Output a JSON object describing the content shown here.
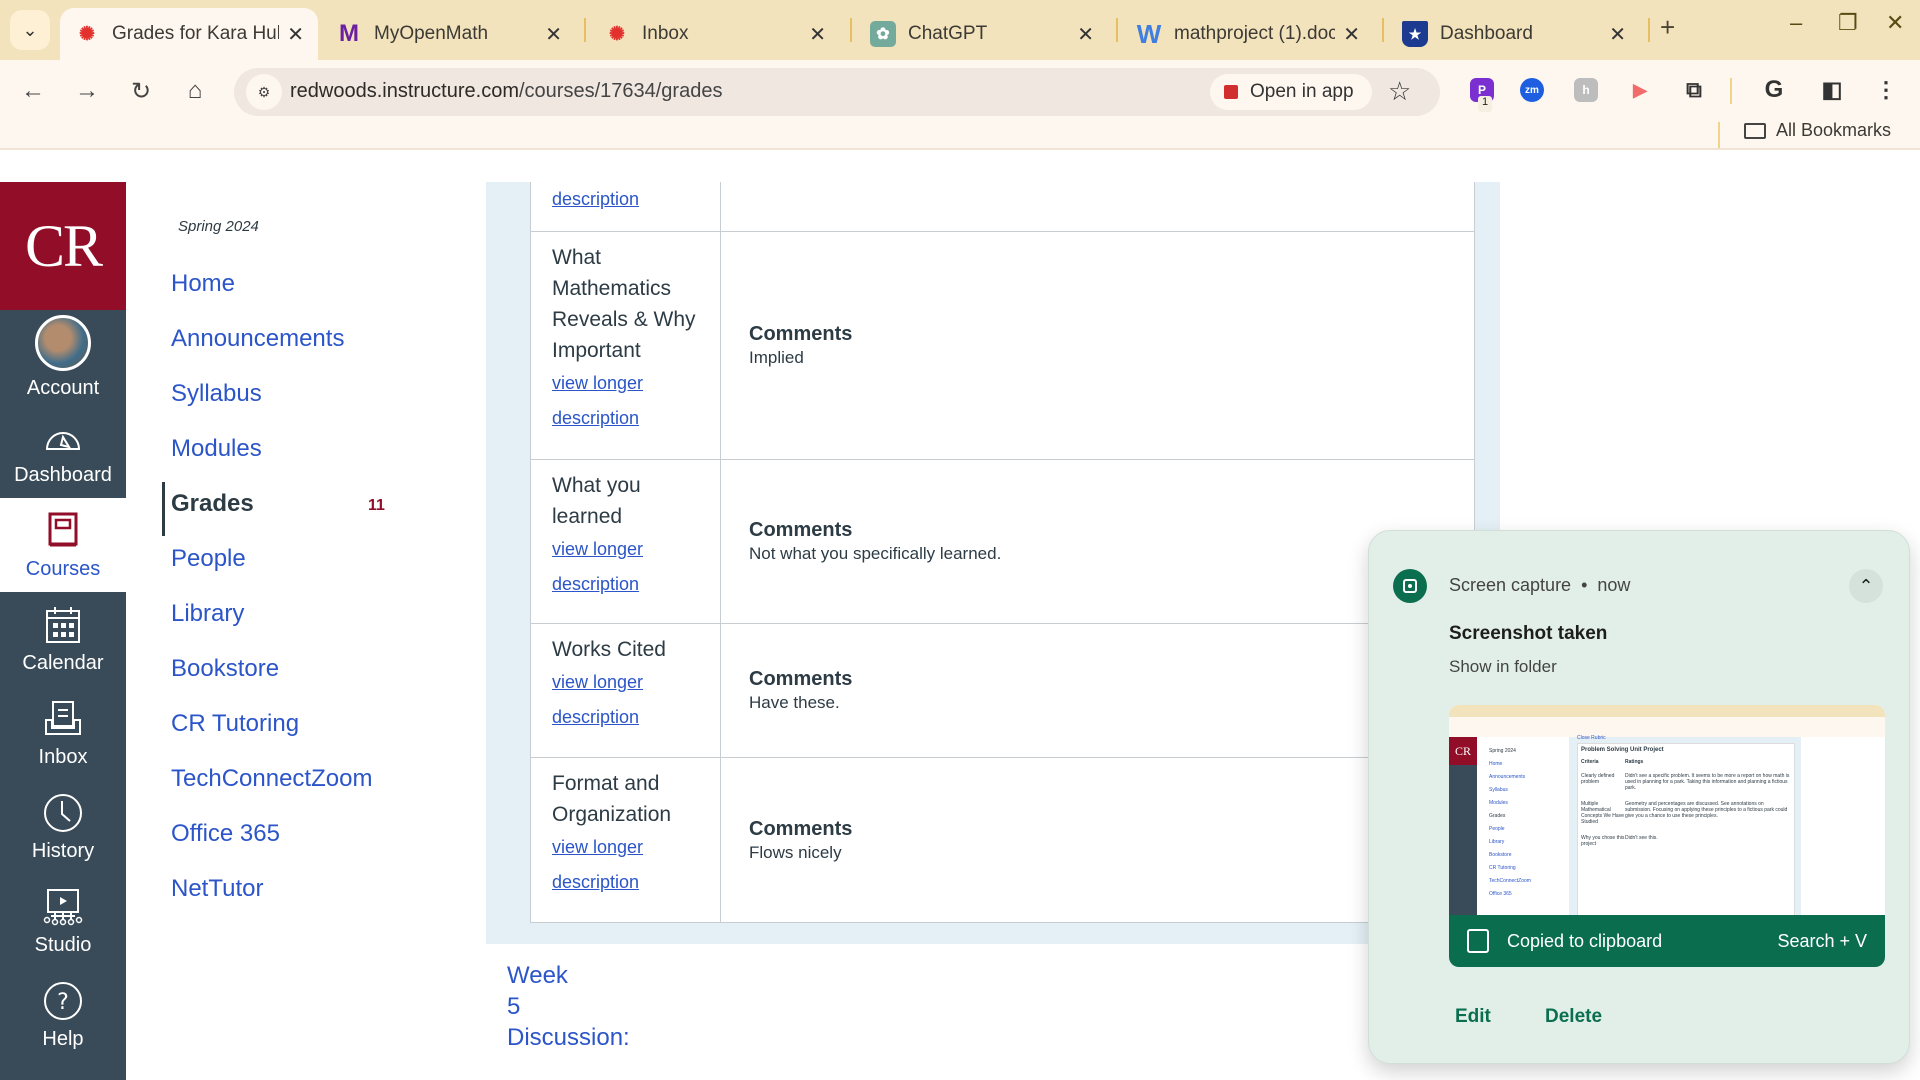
{
  "browser": {
    "tabs": [
      {
        "title": "Grades for Kara Hub",
        "favicon": "canvas-icon",
        "active": true
      },
      {
        "title": "MyOpenMath",
        "favicon": "myopenmath-icon",
        "active": false
      },
      {
        "title": "Inbox",
        "favicon": "canvas-icon",
        "active": false
      },
      {
        "title": "ChatGPT",
        "favicon": "chatgpt-icon",
        "active": false
      },
      {
        "title": "mathproject (1).doc",
        "favicon": "word-icon",
        "active": false
      },
      {
        "title": "Dashboard",
        "favicon": "dashboard-shield-icon",
        "active": false
      }
    ],
    "url_host": "redwoods.instructure.com",
    "url_path": "/courses/17634/grades",
    "open_in_app_label": "Open in app",
    "extension_badge": "1",
    "bookmarks_label": "All Bookmarks"
  },
  "global_nav": {
    "logo": "CR",
    "items": [
      {
        "label": "Account",
        "icon": "avatar"
      },
      {
        "label": "Dashboard",
        "icon": "dashboard-icon"
      },
      {
        "label": "Courses",
        "icon": "courses-icon",
        "active": true
      },
      {
        "label": "Calendar",
        "icon": "calendar-icon"
      },
      {
        "label": "Inbox",
        "icon": "inbox-icon"
      },
      {
        "label": "History",
        "icon": "history-icon"
      },
      {
        "label": "Studio",
        "icon": "studio-icon"
      },
      {
        "label": "Help",
        "icon": "help-icon"
      }
    ]
  },
  "course_nav": {
    "term": "Spring 2024",
    "items": [
      {
        "label": "Home"
      },
      {
        "label": "Announcements"
      },
      {
        "label": "Syllabus"
      },
      {
        "label": "Modules"
      },
      {
        "label": "Grades",
        "active": true,
        "badge": "11"
      },
      {
        "label": "People"
      },
      {
        "label": "Library"
      },
      {
        "label": "Bookstore"
      },
      {
        "label": "CR Tutoring"
      },
      {
        "label": "TechConnectZoom"
      },
      {
        "label": "Office 365"
      },
      {
        "label": "NetTutor"
      }
    ]
  },
  "rubric": {
    "partial_link": "description",
    "link_line1": "view longer",
    "link_line2": "description",
    "comments_heading": "Comments",
    "rows": [
      {
        "criterion": "What Mathematics Reveals & Why Important",
        "comment": "Implied"
      },
      {
        "criterion": "What you learned",
        "comment": "Not what you specifically learned."
      },
      {
        "criterion": "Works Cited",
        "comment": "Have these."
      },
      {
        "criterion": "Format and Organization",
        "comment": "Flows nicely"
      }
    ]
  },
  "next_item": "Week 5 Discussion:",
  "notification": {
    "source": "Screen capture",
    "time": "now",
    "title": "Screenshot taken",
    "subtitle": "Show in folder",
    "clipboard_label": "Copied to clipboard",
    "shortcut": "Search + V",
    "edit_label": "Edit",
    "delete_label": "Delete",
    "thumbnail": {
      "header": "Problem Solving Unit Project",
      "close_link": "Close Rubric",
      "col1": "Criteria",
      "col2": "Ratings",
      "rows": [
        {
          "criterion": "Clearly defined problem",
          "comment": "Didn't see a specific problem. It seems to be more a report on how math is used in planning for a park. Taking this information and planning a fictious park."
        },
        {
          "criterion": "Multiple Mathematical Concepts We Have Studied",
          "comment": "Geometry and percentages are discussed. See annotations on submission. Focusing on applying these principles to a fictious park could give you a chance to use these principles."
        },
        {
          "criterion": "Why you chose this project",
          "comment": "Didn't see this."
        }
      ]
    }
  },
  "colors": {
    "canvas_brand": "#920d28",
    "nav_dark": "#394b58",
    "link": "#2b55c8",
    "notif_green": "#0a6e4e"
  }
}
